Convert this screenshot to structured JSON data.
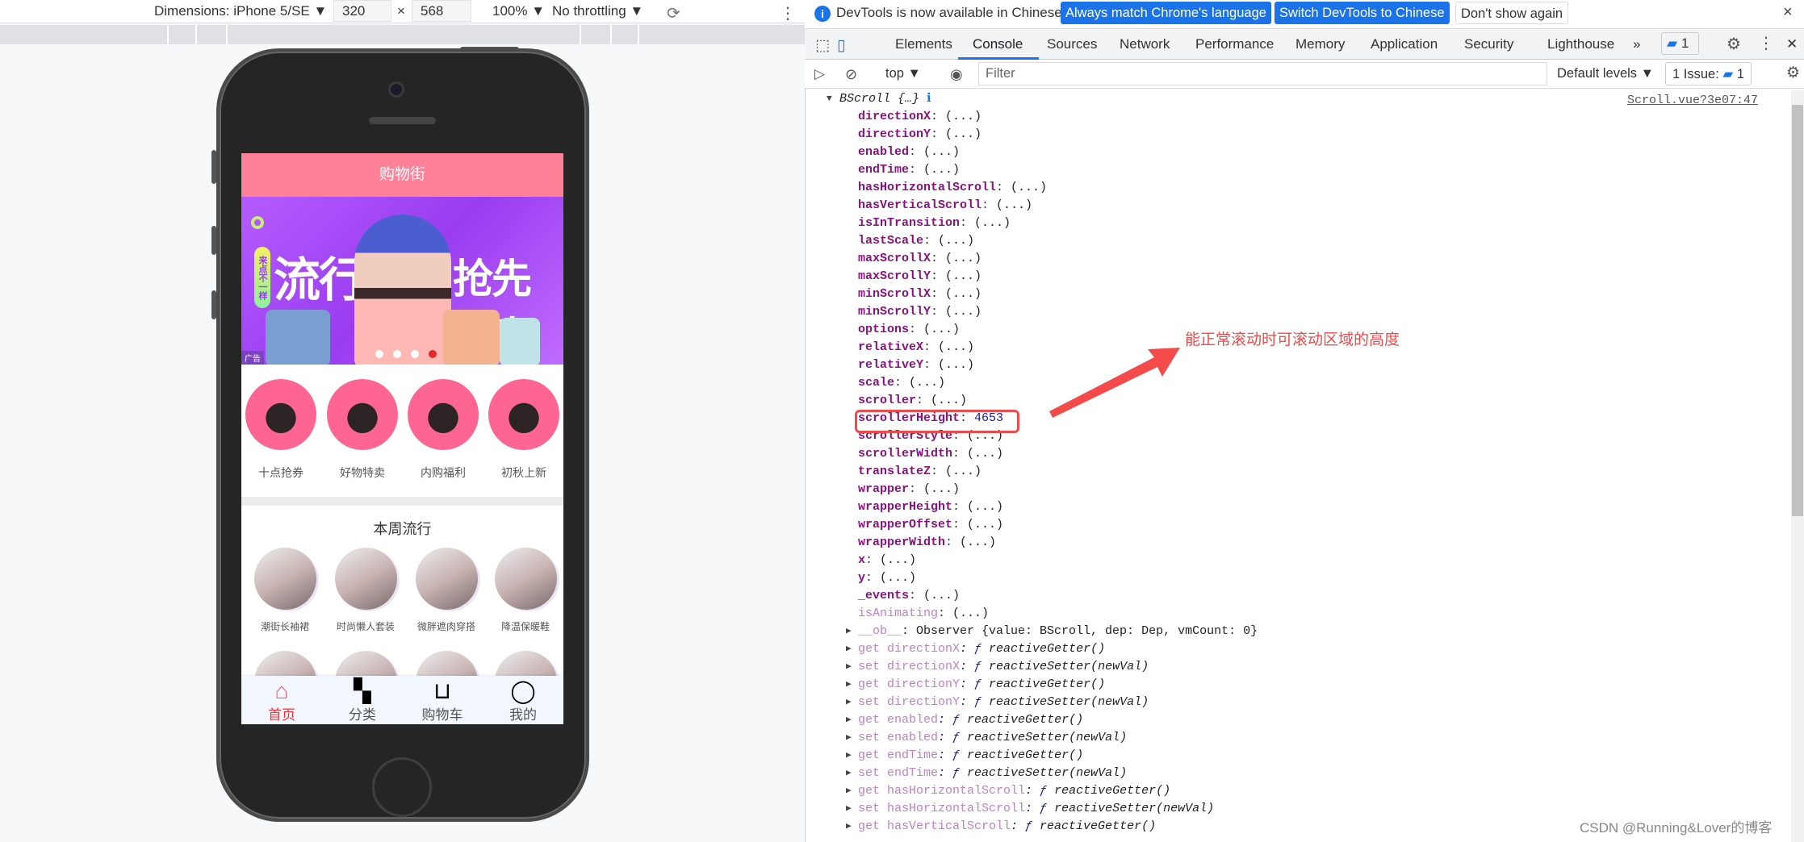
{
  "device_toolbar": {
    "dimensions_label": "Dimensions: iPhone 5/SE ▼",
    "width": "320",
    "height": "568",
    "times": "×",
    "zoom": "100% ▼",
    "throttling": "No throttling ▼",
    "rotate_icon": "rotate-icon",
    "more_icon": "⋮"
  },
  "app": {
    "header_title": "购物街",
    "banner": {
      "text_left": "流行",
      "text_right": "抢先一步",
      "tag": "来点不一样",
      "ad_label": "广告",
      "slides": 4,
      "active_slide": 4
    },
    "categories": [
      "十点抢券",
      "好物特卖",
      "内购福利",
      "初秋上新"
    ],
    "weekly_title": "本周流行",
    "weekly_items": [
      "潮街长袖裙",
      "时尚懒人套装",
      "微胖遮肉穿搭",
      "降温保暖鞋"
    ],
    "tabbar": [
      {
        "label": "首页",
        "icon": "home-icon",
        "active": true
      },
      {
        "label": "分类",
        "icon": "grid-icon"
      },
      {
        "label": "购物车",
        "icon": "cart-icon"
      },
      {
        "label": "我的",
        "icon": "user-icon"
      }
    ],
    "colors": {
      "header": "#ff8198",
      "active_tab": "#ff2d2d"
    }
  },
  "infobar": {
    "message": "DevTools is now available in Chinese!",
    "btn_match": "Always match Chrome's language",
    "btn_switch": "Switch DevTools to Chinese",
    "btn_dismiss": "Don't show again",
    "close": "×"
  },
  "tabs": {
    "items": [
      "Elements",
      "Console",
      "Sources",
      "Network",
      "Performance",
      "Memory",
      "Application",
      "Security",
      "Lighthouse"
    ],
    "active": "Console",
    "more": "»",
    "badge": "1",
    "close": "✕"
  },
  "console_toolbar": {
    "context": "top ▼",
    "filter_placeholder": "Filter",
    "levels": "Default levels ▼",
    "issues": "1 Issue:",
    "issues_count": "1"
  },
  "console": {
    "header": "BScroll {…}",
    "source": "Scroll.vue?3e07:47",
    "props": [
      [
        "directionX",
        "(...)"
      ],
      [
        "directionY",
        "(...)"
      ],
      [
        "enabled",
        "(...)"
      ],
      [
        "endTime",
        "(...)"
      ],
      [
        "hasHorizontalScroll",
        "(...)"
      ],
      [
        "hasVerticalScroll",
        "(...)"
      ],
      [
        "isInTransition",
        "(...)"
      ],
      [
        "lastScale",
        "(...)"
      ],
      [
        "maxScrollX",
        "(...)"
      ],
      [
        "maxScrollY",
        "(...)"
      ],
      [
        "minScrollX",
        "(...)"
      ],
      [
        "minScrollY",
        "(...)"
      ],
      [
        "options",
        "(...)"
      ],
      [
        "relativeX",
        "(...)"
      ],
      [
        "relativeY",
        "(...)"
      ],
      [
        "scale",
        "(...)"
      ],
      [
        "scroller",
        "(...)"
      ],
      [
        "scrollerHeight",
        "4653"
      ],
      [
        "scrollerStyle",
        "(...)"
      ],
      [
        "scrollerWidth",
        "(...)"
      ],
      [
        "translateZ",
        "(...)"
      ],
      [
        "wrapper",
        "(...)"
      ],
      [
        "wrapperHeight",
        "(...)"
      ],
      [
        "wrapperOffset",
        "(...)"
      ],
      [
        "wrapperWidth",
        "(...)"
      ],
      [
        "x",
        "(...)"
      ],
      [
        "y",
        "(...)"
      ],
      [
        "_events",
        "(...)"
      ]
    ],
    "faded_prop": [
      "isAnimating",
      "(...)"
    ],
    "observer": [
      "__ob__",
      ": Observer {value: BScroll, dep: Dep, vmCount: 0}"
    ],
    "accessors": [
      [
        "get directionX",
        "reactiveGetter()"
      ],
      [
        "set directionX",
        "reactiveSetter(newVal)"
      ],
      [
        "get directionY",
        "reactiveGetter()"
      ],
      [
        "set directionY",
        "reactiveSetter(newVal)"
      ],
      [
        "get enabled",
        "reactiveGetter()"
      ],
      [
        "set enabled",
        "reactiveSetter(newVal)"
      ],
      [
        "get endTime",
        "reactiveGetter()"
      ],
      [
        "set endTime",
        "reactiveSetter(newVal)"
      ],
      [
        "get hasHorizontalScroll",
        "reactiveGetter()"
      ],
      [
        "set hasHorizontalScroll",
        "reactiveSetter(newVal)"
      ],
      [
        "get hasVerticalScroll",
        "reactiveGetter()"
      ]
    ]
  },
  "annotation": {
    "text": "能正常滚动时可滚动区域的高度",
    "color": "#f04a4a",
    "highlighted_key": "scrollerHeight"
  },
  "watermark": "CSDN @Running&Lover的博客"
}
